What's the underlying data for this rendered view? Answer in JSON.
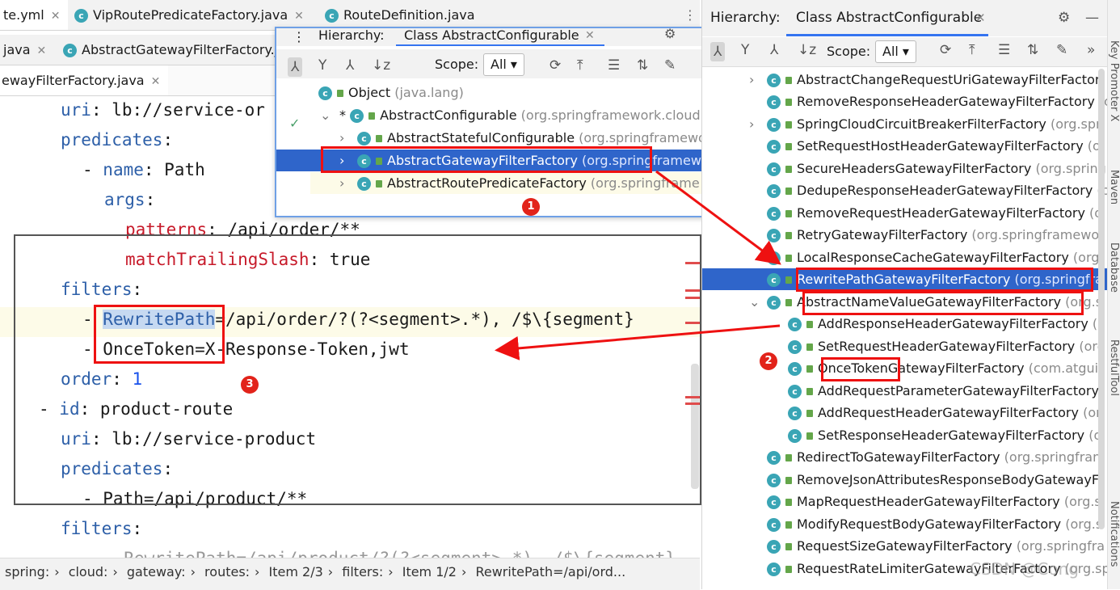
{
  "editor_tabs_row1": [
    {
      "label": "te.yml"
    },
    {
      "label": "VipRoutePredicateFactory.java"
    },
    {
      "label": "RouteDefinition.java"
    }
  ],
  "editor_tabs_row2": [
    {
      "label": "java"
    },
    {
      "label": "AbstractGatewayFilterFactory.j"
    }
  ],
  "editor_tabs_row3": [
    {
      "label": "ewayFilterFactory.java"
    }
  ],
  "code": {
    "l1_key": "uri",
    "l1_val": ": lb://service-or",
    "l2_key": "predicates",
    "l2_val": ":",
    "l3_dash": "- ",
    "l3_key": "name",
    "l3_val": ": Path",
    "l4_key": "args",
    "l4_val": ":",
    "l5_key": "patterns",
    "l5_val": ": /api/order/**",
    "l6_key": "matchTrailingSlash",
    "l6_val": ": true",
    "l7_key": "filters",
    "l7_val": ":",
    "l8_dash": "- ",
    "l8_hl": "RewritePath",
    "l8_val": "=/api/order/?(?<segment>.*), /$\\{segment}",
    "l9_dash": "- ",
    "l9_val": "OnceToken=X-Response-Token,jwt",
    "l10_key": "order",
    "l10_colon": ": ",
    "l10_num": "1",
    "l11_dash": "- ",
    "l11_key": "id",
    "l11_val": ": product-route",
    "l12_key": "uri",
    "l12_val": ": lb://service-product",
    "l13_key": "predicates",
    "l13_val": ":",
    "l14_val": "- Path=/api/product/**",
    "l15_key": "filters",
    "l15_val": ":",
    "l16_val": "- RewritePath=/api/product/?(?<segment>.*), /$\\{segment}"
  },
  "breadcrumb": [
    "spring:",
    "cloud:",
    "gateway:",
    "routes:",
    "Item 2/3",
    "filters:",
    "Item 1/2",
    "RewritePath=/api/ord..."
  ],
  "popup": {
    "header_label": "Hierarchy:",
    "tab_label": "Class AbstractConfigurable",
    "scope_label": "Scope:",
    "scope_value": "All",
    "rows": [
      {
        "name": "Object",
        "pkg": "(java.lang)"
      },
      {
        "name": "AbstractConfigurable",
        "pkg": "(org.springframework.cloud"
      },
      {
        "name": "AbstractStatefulConfigurable",
        "pkg": "(org.springframewo"
      },
      {
        "name": "AbstractGatewayFilterFactory",
        "pkg": "(org.springframew"
      },
      {
        "name": "AbstractRoutePredicateFactory",
        "pkg": "(org.springframe"
      }
    ]
  },
  "right_panel": {
    "header_label": "Hierarchy:",
    "tab_label": "Class AbstractConfigurable",
    "scope_label": "Scope:",
    "scope_value": "All",
    "rows": [
      {
        "name": "AbstractChangeRequestUriGatewayFilterFactor",
        "pkg": ""
      },
      {
        "name": "RemoveResponseHeaderGatewayFilterFactory",
        "pkg": "(o"
      },
      {
        "name": "SpringCloudCircuitBreakerFilterFactory",
        "pkg": "(org.spr"
      },
      {
        "name": "SetRequestHostHeaderGatewayFilterFactory",
        "pkg": "(o"
      },
      {
        "name": "SecureHeadersGatewayFilterFactory",
        "pkg": "(org.spring"
      },
      {
        "name": "DedupeResponseHeaderGatewayFilterFactory",
        "pkg": "(o"
      },
      {
        "name": "RemoveRequestHeaderGatewayFilterFactory",
        "pkg": "(o"
      },
      {
        "name": "RetryGatewayFilterFactory",
        "pkg": "(org.springframewor"
      },
      {
        "name": "LocalResponseCacheGatewayFilterFactory",
        "pkg": "(org"
      },
      {
        "name": "RewritePathGatewayFilterFactory",
        "pkg": "(org.springfra"
      },
      {
        "name": "AbstractNameValueGatewayFilterFactory",
        "pkg": "(org.s"
      },
      {
        "name": "AddResponseHeaderGatewayFilterFactory",
        "pkg": "(o"
      },
      {
        "name": "SetRequestHeaderGatewayFilterFactory",
        "pkg": "(org"
      },
      {
        "name": "OnceTokenGatewayFilterFactory",
        "pkg": "(com.atgui"
      },
      {
        "name": "AddRequestParameterGatewayFilterFactory",
        "pkg": ""
      },
      {
        "name": "AddRequestHeaderGatewayFilterFactory",
        "pkg": "(or"
      },
      {
        "name": "SetResponseHeaderGatewayFilterFactory",
        "pkg": "(o"
      },
      {
        "name": "RedirectToGatewayFilterFactory",
        "pkg": "(org.springfran"
      },
      {
        "name": "RemoveJsonAttributesResponseBodyGatewayF",
        "pkg": ""
      },
      {
        "name": "MapRequestHeaderGatewayFilterFactory",
        "pkg": "(org.s"
      },
      {
        "name": "ModifyRequestBodyGatewayFilterFactory",
        "pkg": "(org.s"
      },
      {
        "name": "RequestSizeGatewayFilterFactory",
        "pkg": "(org.springfra"
      },
      {
        "name": "RequestRateLimiterGatewayFilterFactory",
        "pkg": "(org.spri"
      }
    ]
  },
  "side_tools": [
    "Key Promoter X",
    "Maven",
    "Database",
    "RestfulTool",
    "Notifications"
  ],
  "annotations": [
    "1",
    "2",
    "3"
  ],
  "watermark": "CSDN @Cong"
}
